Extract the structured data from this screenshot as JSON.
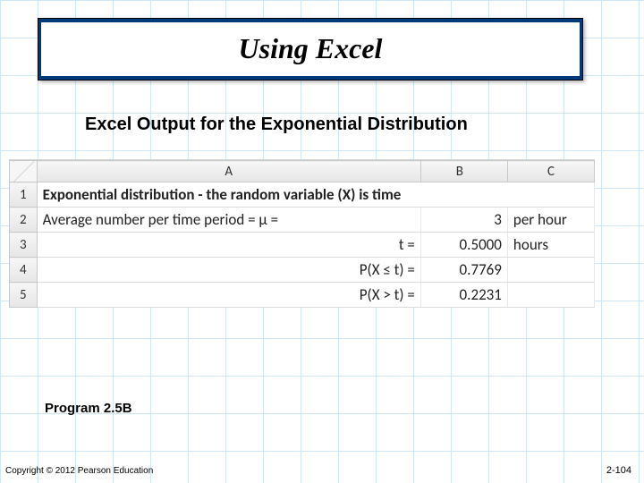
{
  "title": "Using Excel",
  "subtitle": "Excel Output for the Exponential Distribution",
  "excel": {
    "columns": [
      "A",
      "B",
      "C"
    ],
    "rows": [
      {
        "n": "1",
        "a": "Exponential distribution - the random variable (X) is time",
        "b": "",
        "c": ""
      },
      {
        "n": "2",
        "a": "Average number per time period = μ =",
        "b": "3",
        "c": "per hour"
      },
      {
        "n": "3",
        "a": "t  =",
        "b": "0.5000",
        "c": "hours"
      },
      {
        "n": "4",
        "a": "P(X ≤ t) =",
        "b": "0.7769",
        "c": ""
      },
      {
        "n": "5",
        "a": "P(X > t) =",
        "b": "0.2231",
        "c": ""
      }
    ]
  },
  "program_label": "Program 2.5B",
  "copyright": "Copyright © 2012 Pearson Education",
  "page_number": "2-104",
  "chart_data": {
    "type": "table",
    "title": "Excel Output for the Exponential Distribution",
    "parameters": {
      "mu": 3,
      "mu_unit": "per hour",
      "t": 0.5,
      "t_unit": "hours"
    },
    "results": {
      "P(X<=t)": 0.7769,
      "P(X>t)": 0.2231
    }
  }
}
